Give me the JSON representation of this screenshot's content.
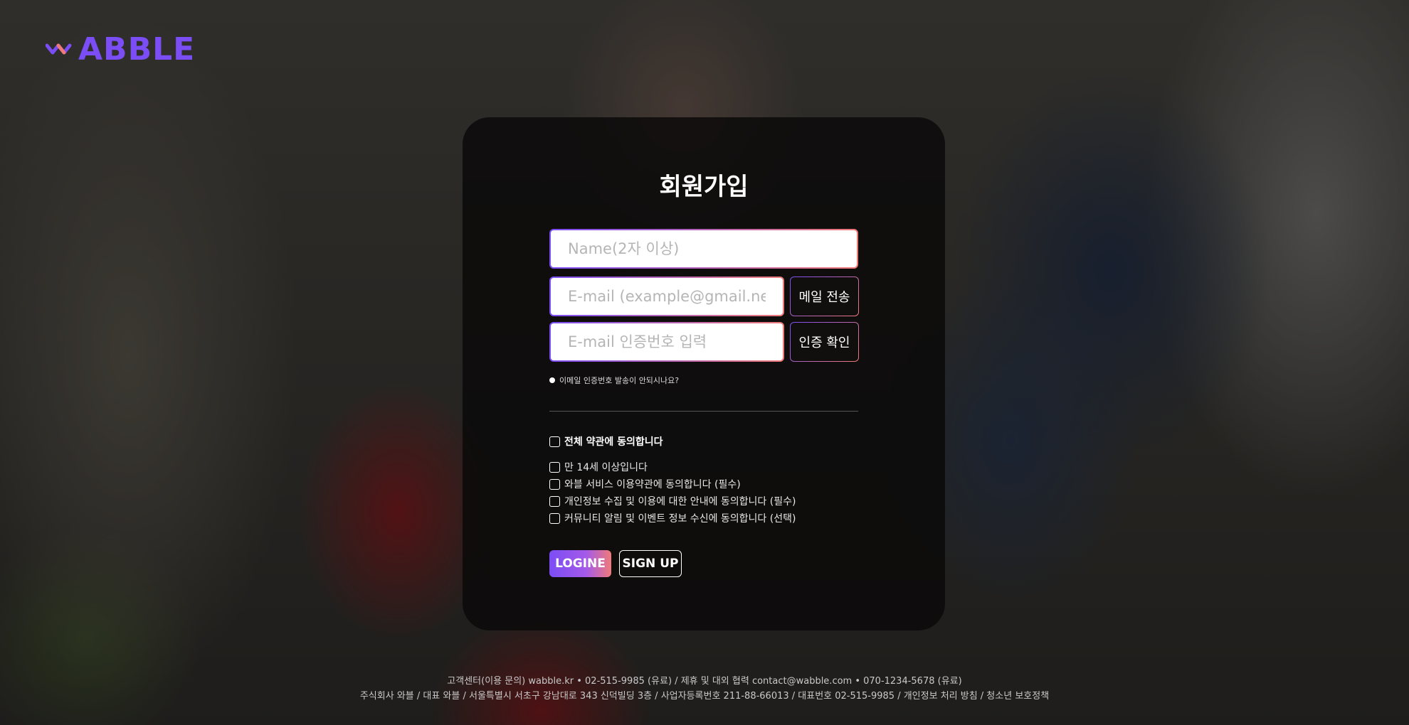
{
  "brand": {
    "logo_text": "ABBLE",
    "logo_icon": "wave-logo-icon",
    "accent": "#7b4df5",
    "accent_end": "#f07a7a"
  },
  "form": {
    "title": "회원가입",
    "name_placeholder": "Name(2자 이상)",
    "email_placeholder": "E-mail (example@gmail.net)",
    "code_placeholder": "E-mail 인증번호 입력",
    "send_mail_label": "메일 전송",
    "verify_label": "인증 확인",
    "help_text": "이메일 인증번호 발송이 안되시나요?"
  },
  "terms": {
    "all_label": "전체 약관에 동의합니다",
    "items": [
      {
        "label": "만 14세 이상입니다"
      },
      {
        "label": "와블 서비스 이용약관에 동의합니다 (필수)"
      },
      {
        "label": "개인정보 수집 및 이용에 대한 안내에 동의합니다 (필수)"
      },
      {
        "label": "커뮤니티 알림 및 이벤트 정보 수신에 동의합니다 (선택)"
      }
    ]
  },
  "buttons": {
    "login_label": "LOGINE",
    "signup_label": "SIGN UP"
  },
  "footer": {
    "line1": "고객센터(이용 문의)  wabble.kr  •  02-515-9985 (유료)    /    제휴 및 대외 협력  contact@wabble.com  •  070-1234-5678 (유료)",
    "line2": "주식회사 와블 / 대표 와블 / 서울특별시 서초구 강남대로 343 신덕빌딩 3층 / 사업자등록번호 211-88-66013 / 대표번호 02-515-9985 / 개인정보 처리 방침 / 청소년 보호정책"
  }
}
